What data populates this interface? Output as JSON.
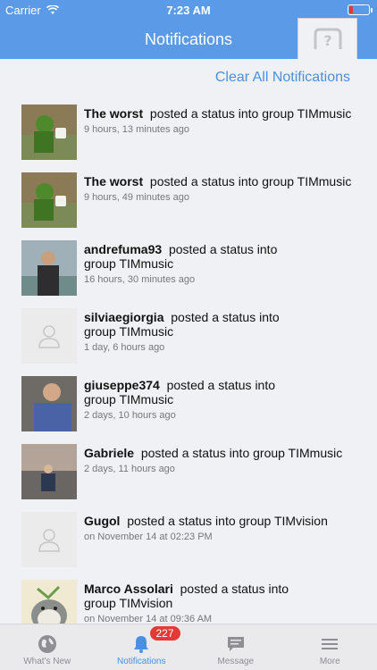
{
  "status_bar": {
    "carrier": "Carrier",
    "time": "7:23 AM"
  },
  "header": {
    "title": "Notifications"
  },
  "actions": {
    "clear_all": "Clear All Notifications"
  },
  "notifications": [
    {
      "name": "The worst",
      "action": "posted a status into group TIMmusic",
      "time": "9 hours, 13 minutes ago",
      "avatar": "kermit-tea-photo"
    },
    {
      "name": "The worst",
      "action": "posted a status into group TIMmusic",
      "time": "9 hours, 49 minutes ago",
      "avatar": "kermit-tea-photo"
    },
    {
      "name": "andrefuma93",
      "action": "posted a status into group TIMmusic",
      "time": "16 hours, 30 minutes ago",
      "avatar": "man-outdoor-photo"
    },
    {
      "name": "silviaegiorgia",
      "action": "posted a status into group TIMmusic",
      "time": "1 day, 6 hours ago",
      "avatar": "default-person"
    },
    {
      "name": "giuseppe374",
      "action": "posted a status into group TIMmusic",
      "time": "2 days, 10 hours ago",
      "avatar": "man-blue-shirt-photo"
    },
    {
      "name": "Gabriele",
      "action": "posted a status into group TIMmusic",
      "time": "2 days, 11 hours ago",
      "avatar": "sunset-sea-photo"
    },
    {
      "name": "Gugol",
      "action": "posted a status into group TIMvision",
      "time": "on November 14 at 02:23 PM",
      "avatar": "default-person"
    },
    {
      "name": "Marco Assolari",
      "action": "posted a status into group TIMvision",
      "time": "on November 14 at 09:36 AM",
      "avatar": "totoro-cartoon"
    }
  ],
  "tabbar": {
    "tabs": [
      {
        "label": "What's New",
        "icon": "globe-icon"
      },
      {
        "label": "Notifications",
        "icon": "bell-icon",
        "badge": "227"
      },
      {
        "label": "Message",
        "icon": "chat-icon"
      },
      {
        "label": "More",
        "icon": "menu-icon"
      }
    ]
  },
  "colors": {
    "header": "#5b9ae6",
    "accent": "#4a8fe0",
    "badge": "#e53935"
  }
}
